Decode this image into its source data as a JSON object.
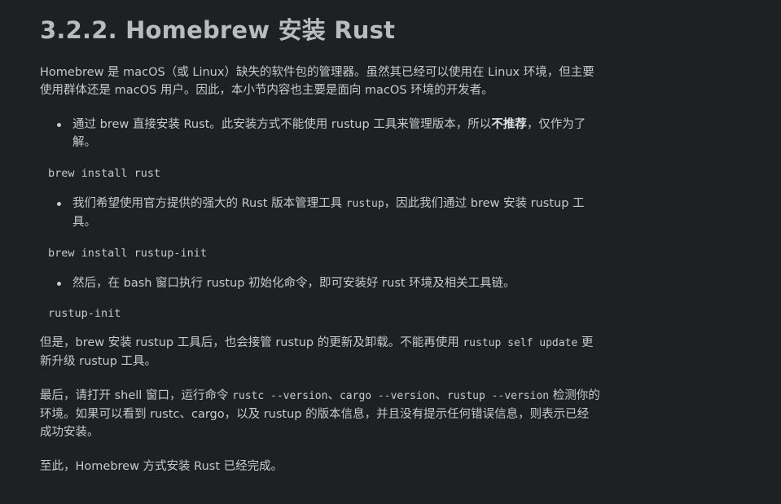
{
  "heading": "3.2.2. Homebrew 安装 Rust",
  "intro": {
    "line1": "Homebrew 是 macOS（或 Linux）缺失的软件包的管理器。虽然其已经可以使用在 Linux 环境，但主要",
    "line2": "使用群体还是 macOS 用户。因此，本小节内容也主要是面向 macOS 环境的开发者。"
  },
  "bullet1": {
    "part1": "通过 brew 直接安装 Rust。此安装方式不能使用 rustup 工具来管理版本，所以",
    "bold": "不推荐",
    "part2": "，仅作为了",
    "line2": "解。"
  },
  "code1": "brew install rust",
  "bullet2": {
    "part1": "我们希望使用官方提供的强大的 Rust 版本管理工具 ",
    "code": "rustup",
    "part2": "，因此我们通过 brew 安装 rustup 工",
    "line2": "具。"
  },
  "code2": "brew install rustup-init",
  "bullet3": {
    "text": "然后，在 bash 窗口执行 rustup 初始化命令，即可安装好 rust 环境及相关工具链。"
  },
  "code3": "rustup-init",
  "para2": {
    "part1": "但是，brew 安装 rustup 工具后，也会接管 rustup 的更新及卸载。不能再使用 ",
    "code": "rustup self update",
    "part2": " 更",
    "line2": "新升级 rustup 工具。"
  },
  "para3": {
    "part1": "最后，请打开 shell 窗口，运行命令 ",
    "code1": "rustc --version",
    "sep1": "、",
    "code2": "cargo --version",
    "sep2": "、",
    "code3": "rustup --version",
    "part2": " 检测你的",
    "line2": "环境。如果可以看到 rustc、cargo，以及 rustup 的版本信息，并且没有提示任何错误信息，则表示已经",
    "line3": "成功安装。"
  },
  "para4": "至此，Homebrew 方式安装 Rust 已经完成。"
}
